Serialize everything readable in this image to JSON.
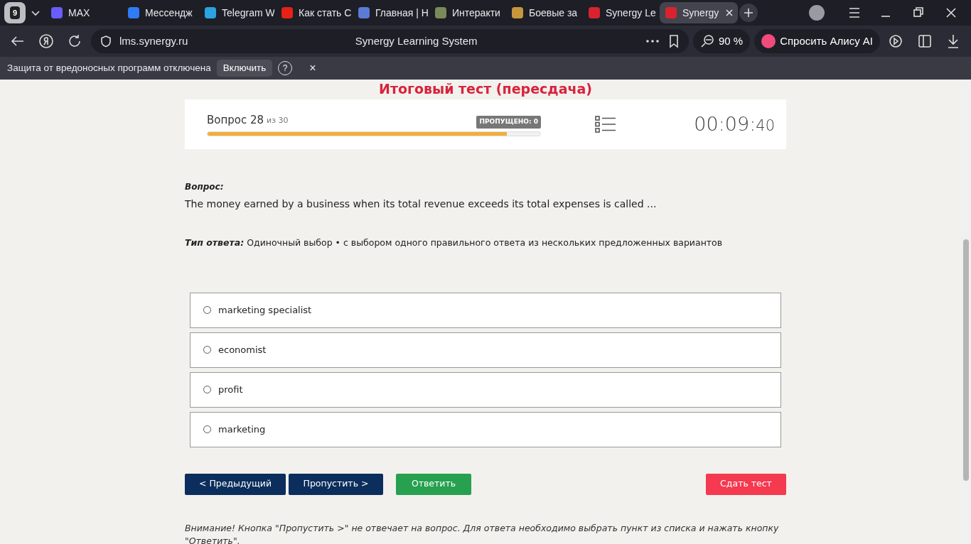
{
  "browser": {
    "tab_counter": "9",
    "tabs": [
      {
        "label": "MAX",
        "selected": false,
        "color": "#6a5cff"
      },
      {
        "label": "Мессендж",
        "selected": false,
        "color": "#2f7cf6"
      },
      {
        "label": "Telegram W",
        "selected": false,
        "color": "#2aa3e0"
      },
      {
        "label": "Как стать С",
        "selected": false,
        "color": "#e62117"
      },
      {
        "label": "Главная | Н",
        "selected": false,
        "color": "#5b7bd5"
      },
      {
        "label": "Интеракти",
        "selected": false,
        "color": "#7a8a5a"
      },
      {
        "label": "Боевые за",
        "selected": false,
        "color": "#c8963c"
      },
      {
        "label": "Synergy Le",
        "selected": false,
        "color": "#d9232e"
      },
      {
        "label": "Synergy",
        "selected": true,
        "color": "#d9232e"
      }
    ],
    "address": "lms.synergy.ru",
    "page_title": "Synergy Learning System",
    "zoom": "90 %",
    "alice": "Спросить Алису AI",
    "infobar": {
      "message": "Защита от вредоносных программ отключена",
      "button": "Включить",
      "help": "?",
      "close": "×"
    }
  },
  "test": {
    "title": "Итоговый тест (пересдача)",
    "question_label": "Вопрос 28",
    "of": "из 30",
    "skipped": "ПРОПУЩЕНО: 0",
    "level": 0.9,
    "timer_main": "00:09:",
    "timer_seconds": "40"
  },
  "question": {
    "label": "Вопрос:",
    "text": "The money earned by a business when its total revenue exceeds its total expenses is called ...",
    "type_label": "Тип ответа:",
    "type_text": "Одиночный выбор • с выбором одного правильного ответа из нескольких предложенных вариантов"
  },
  "options": [
    {
      "label": "marketing specialist",
      "selected": false
    },
    {
      "label": "economist",
      "selected": false
    },
    {
      "label": "profit",
      "selected": false
    },
    {
      "label": "marketing",
      "selected": false
    }
  ],
  "buttons": {
    "previous": "< Предыдущий",
    "skip": "Пропустить >",
    "answer": "Ответить",
    "finish": "Сдать тест"
  },
  "notice": "Внимание! Кнопка \"Пропустить >\" не отвечает на вопрос. Для ответа необходимо выбрать пункт из списка и нажать кнопку \"Ответить\"."
}
